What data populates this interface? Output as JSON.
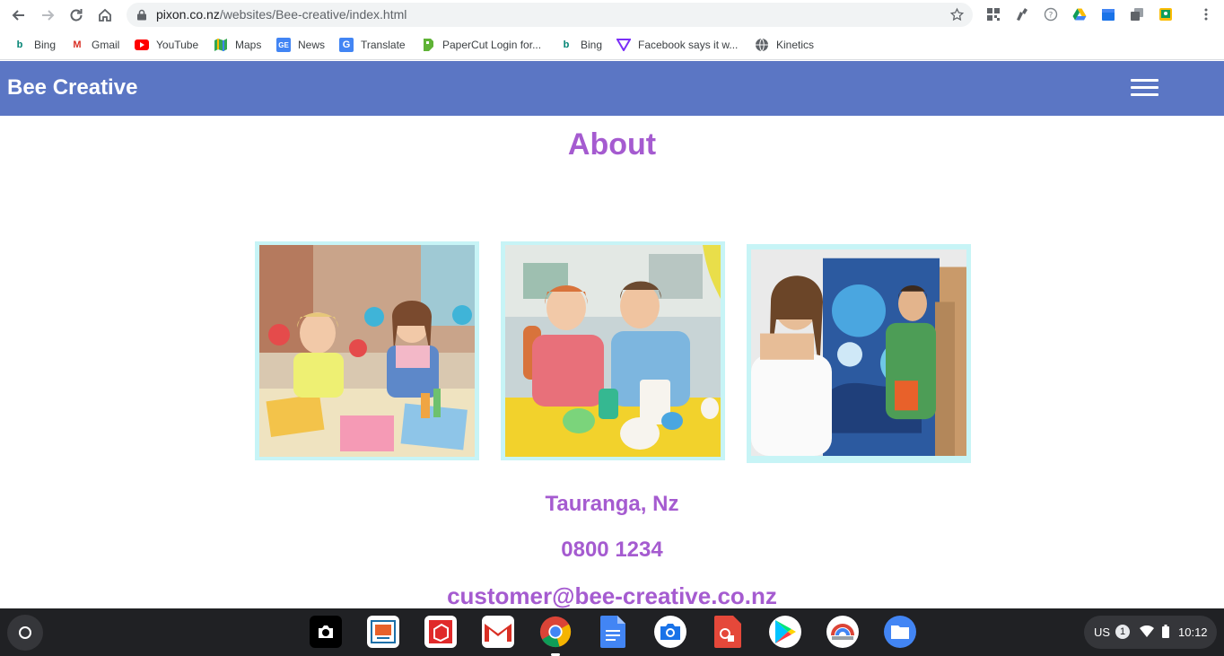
{
  "browser": {
    "url_host": "pixon.co.nz",
    "url_path": "/websites/Bee-creative/index.html"
  },
  "bookmarks": [
    {
      "label": "Bing",
      "icon": "bing-icon"
    },
    {
      "label": "Gmail",
      "icon": "gmail-icon"
    },
    {
      "label": "YouTube",
      "icon": "youtube-icon"
    },
    {
      "label": "Maps",
      "icon": "maps-icon"
    },
    {
      "label": "News",
      "icon": "news-icon"
    },
    {
      "label": "Translate",
      "icon": "translate-icon"
    },
    {
      "label": "PaperCut Login for...",
      "icon": "papercut-icon"
    },
    {
      "label": "Bing",
      "icon": "bing-icon"
    },
    {
      "label": "Facebook says it w...",
      "icon": "verge-icon"
    },
    {
      "label": "Kinetics",
      "icon": "globe-icon"
    }
  ],
  "site": {
    "brand": "Bee Creative",
    "heading": "About",
    "location": "Tauranga, Nz",
    "phone": "0800 1234",
    "email": "customer@bee-creative.co.nz",
    "accent_color": "#a55bd0",
    "header_color": "#5b76c4"
  },
  "gallery": [
    {
      "subject": "two girls with painted hands"
    },
    {
      "subject": "children painting easter eggs"
    },
    {
      "subject": "woman and man painting at easels"
    }
  ],
  "shelf": {
    "ime": "US",
    "notifications": "1",
    "time": "10:12"
  }
}
